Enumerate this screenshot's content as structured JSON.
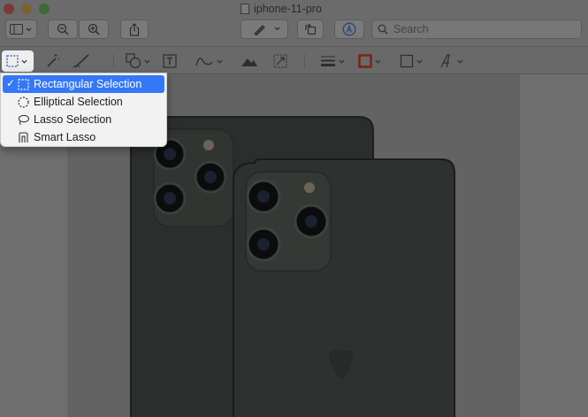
{
  "window": {
    "title": "iphone-11-pro"
  },
  "search": {
    "placeholder": "Search"
  },
  "menu": {
    "items": [
      {
        "label": "Rectangular Selection",
        "checked": true,
        "icon": "rect-select-icon"
      },
      {
        "label": "Elliptical Selection",
        "checked": false,
        "icon": "ellipse-select-icon"
      },
      {
        "label": "Lasso Selection",
        "checked": false,
        "icon": "lasso-icon"
      },
      {
        "label": "Smart Lasso",
        "checked": false,
        "icon": "smart-lasso-icon"
      }
    ],
    "check_mark": "✓"
  },
  "colors": {
    "accent": "#3478f6",
    "menu_bg": "#f2f2f2",
    "dim_overlay": "#6e6e6e",
    "border_color_swatch": "#b02a1e"
  }
}
